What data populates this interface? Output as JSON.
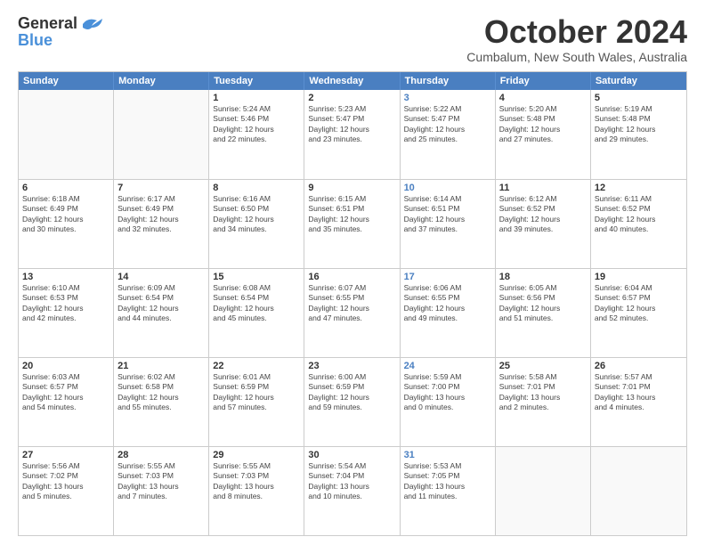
{
  "logo": {
    "general": "General",
    "blue": "Blue"
  },
  "header": {
    "month": "October 2024",
    "location": "Cumbalum, New South Wales, Australia"
  },
  "days": [
    "Sunday",
    "Monday",
    "Tuesday",
    "Wednesday",
    "Thursday",
    "Friday",
    "Saturday"
  ],
  "weeks": [
    [
      {
        "num": "",
        "lines": [],
        "empty": true
      },
      {
        "num": "",
        "lines": [],
        "empty": true
      },
      {
        "num": "1",
        "lines": [
          "Sunrise: 5:24 AM",
          "Sunset: 5:46 PM",
          "Daylight: 12 hours",
          "and 22 minutes."
        ]
      },
      {
        "num": "2",
        "lines": [
          "Sunrise: 5:23 AM",
          "Sunset: 5:47 PM",
          "Daylight: 12 hours",
          "and 23 minutes."
        ]
      },
      {
        "num": "3",
        "lines": [
          "Sunrise: 5:22 AM",
          "Sunset: 5:47 PM",
          "Daylight: 12 hours",
          "and 25 minutes."
        ],
        "thursday": true
      },
      {
        "num": "4",
        "lines": [
          "Sunrise: 5:20 AM",
          "Sunset: 5:48 PM",
          "Daylight: 12 hours",
          "and 27 minutes."
        ]
      },
      {
        "num": "5",
        "lines": [
          "Sunrise: 5:19 AM",
          "Sunset: 5:48 PM",
          "Daylight: 12 hours",
          "and 29 minutes."
        ]
      }
    ],
    [
      {
        "num": "6",
        "lines": [
          "Sunrise: 6:18 AM",
          "Sunset: 6:49 PM",
          "Daylight: 12 hours",
          "and 30 minutes."
        ]
      },
      {
        "num": "7",
        "lines": [
          "Sunrise: 6:17 AM",
          "Sunset: 6:49 PM",
          "Daylight: 12 hours",
          "and 32 minutes."
        ]
      },
      {
        "num": "8",
        "lines": [
          "Sunrise: 6:16 AM",
          "Sunset: 6:50 PM",
          "Daylight: 12 hours",
          "and 34 minutes."
        ]
      },
      {
        "num": "9",
        "lines": [
          "Sunrise: 6:15 AM",
          "Sunset: 6:51 PM",
          "Daylight: 12 hours",
          "and 35 minutes."
        ]
      },
      {
        "num": "10",
        "lines": [
          "Sunrise: 6:14 AM",
          "Sunset: 6:51 PM",
          "Daylight: 12 hours",
          "and 37 minutes."
        ],
        "thursday": true
      },
      {
        "num": "11",
        "lines": [
          "Sunrise: 6:12 AM",
          "Sunset: 6:52 PM",
          "Daylight: 12 hours",
          "and 39 minutes."
        ]
      },
      {
        "num": "12",
        "lines": [
          "Sunrise: 6:11 AM",
          "Sunset: 6:52 PM",
          "Daylight: 12 hours",
          "and 40 minutes."
        ]
      }
    ],
    [
      {
        "num": "13",
        "lines": [
          "Sunrise: 6:10 AM",
          "Sunset: 6:53 PM",
          "Daylight: 12 hours",
          "and 42 minutes."
        ]
      },
      {
        "num": "14",
        "lines": [
          "Sunrise: 6:09 AM",
          "Sunset: 6:54 PM",
          "Daylight: 12 hours",
          "and 44 minutes."
        ]
      },
      {
        "num": "15",
        "lines": [
          "Sunrise: 6:08 AM",
          "Sunset: 6:54 PM",
          "Daylight: 12 hours",
          "and 45 minutes."
        ]
      },
      {
        "num": "16",
        "lines": [
          "Sunrise: 6:07 AM",
          "Sunset: 6:55 PM",
          "Daylight: 12 hours",
          "and 47 minutes."
        ]
      },
      {
        "num": "17",
        "lines": [
          "Sunrise: 6:06 AM",
          "Sunset: 6:55 PM",
          "Daylight: 12 hours",
          "and 49 minutes."
        ],
        "thursday": true
      },
      {
        "num": "18",
        "lines": [
          "Sunrise: 6:05 AM",
          "Sunset: 6:56 PM",
          "Daylight: 12 hours",
          "and 51 minutes."
        ]
      },
      {
        "num": "19",
        "lines": [
          "Sunrise: 6:04 AM",
          "Sunset: 6:57 PM",
          "Daylight: 12 hours",
          "and 52 minutes."
        ]
      }
    ],
    [
      {
        "num": "20",
        "lines": [
          "Sunrise: 6:03 AM",
          "Sunset: 6:57 PM",
          "Daylight: 12 hours",
          "and 54 minutes."
        ]
      },
      {
        "num": "21",
        "lines": [
          "Sunrise: 6:02 AM",
          "Sunset: 6:58 PM",
          "Daylight: 12 hours",
          "and 55 minutes."
        ]
      },
      {
        "num": "22",
        "lines": [
          "Sunrise: 6:01 AM",
          "Sunset: 6:59 PM",
          "Daylight: 12 hours",
          "and 57 minutes."
        ]
      },
      {
        "num": "23",
        "lines": [
          "Sunrise: 6:00 AM",
          "Sunset: 6:59 PM",
          "Daylight: 12 hours",
          "and 59 minutes."
        ]
      },
      {
        "num": "24",
        "lines": [
          "Sunrise: 5:59 AM",
          "Sunset: 7:00 PM",
          "Daylight: 13 hours",
          "and 0 minutes."
        ],
        "thursday": true
      },
      {
        "num": "25",
        "lines": [
          "Sunrise: 5:58 AM",
          "Sunset: 7:01 PM",
          "Daylight: 13 hours",
          "and 2 minutes."
        ]
      },
      {
        "num": "26",
        "lines": [
          "Sunrise: 5:57 AM",
          "Sunset: 7:01 PM",
          "Daylight: 13 hours",
          "and 4 minutes."
        ]
      }
    ],
    [
      {
        "num": "27",
        "lines": [
          "Sunrise: 5:56 AM",
          "Sunset: 7:02 PM",
          "Daylight: 13 hours",
          "and 5 minutes."
        ]
      },
      {
        "num": "28",
        "lines": [
          "Sunrise: 5:55 AM",
          "Sunset: 7:03 PM",
          "Daylight: 13 hours",
          "and 7 minutes."
        ]
      },
      {
        "num": "29",
        "lines": [
          "Sunrise: 5:55 AM",
          "Sunset: 7:03 PM",
          "Daylight: 13 hours",
          "and 8 minutes."
        ]
      },
      {
        "num": "30",
        "lines": [
          "Sunrise: 5:54 AM",
          "Sunset: 7:04 PM",
          "Daylight: 13 hours",
          "and 10 minutes."
        ]
      },
      {
        "num": "31",
        "lines": [
          "Sunrise: 5:53 AM",
          "Sunset: 7:05 PM",
          "Daylight: 13 hours",
          "and 11 minutes."
        ],
        "thursday": true
      },
      {
        "num": "",
        "lines": [],
        "empty": true
      },
      {
        "num": "",
        "lines": [],
        "empty": true
      }
    ]
  ]
}
